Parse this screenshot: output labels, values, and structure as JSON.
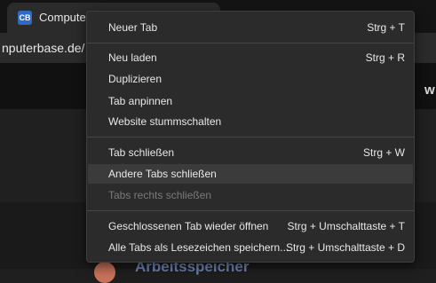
{
  "tab": {
    "title": "Computer",
    "favicon_text": "CB"
  },
  "address": {
    "url": "nputerbase.de/"
  },
  "page": {
    "heading_fragment": "w",
    "bottom_text": "Arbeitsspeicher"
  },
  "menu": {
    "items": [
      {
        "label": "Neuer Tab",
        "shortcut": "Strg + T"
      },
      {
        "label": "Neu laden",
        "shortcut": "Strg + R"
      },
      {
        "label": "Duplizieren",
        "shortcut": ""
      },
      {
        "label": "Tab anpinnen",
        "shortcut": ""
      },
      {
        "label": "Website stummschalten",
        "shortcut": ""
      },
      {
        "label": "Tab schließen",
        "shortcut": "Strg + W"
      },
      {
        "label": "Andere Tabs schließen",
        "shortcut": ""
      },
      {
        "label": "Tabs rechts schließen",
        "shortcut": ""
      },
      {
        "label": "Geschlossenen Tab wieder öffnen",
        "shortcut": "Strg + Umschalttaste + T"
      },
      {
        "label": "Alle Tabs als Lesezeichen speichern...",
        "shortcut": "Strg + Umschalttaste + D"
      }
    ]
  }
}
